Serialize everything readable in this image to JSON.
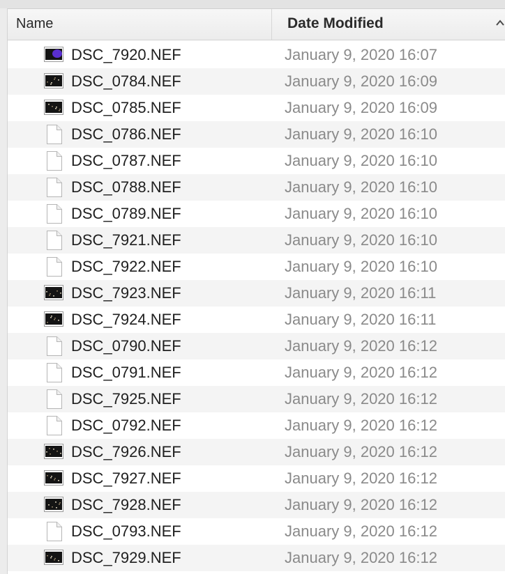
{
  "header": {
    "name_label": "Name",
    "date_label": "Date Modified"
  },
  "files": [
    {
      "name": "DSC_7920.NEF",
      "date": "January 9, 2020 16:07",
      "icon": "image-thumbnail-icon-purple"
    },
    {
      "name": "DSC_0784.NEF",
      "date": "January 9, 2020 16:09",
      "icon": "image-thumbnail-icon"
    },
    {
      "name": "DSC_0785.NEF",
      "date": "January 9, 2020 16:09",
      "icon": "image-thumbnail-icon"
    },
    {
      "name": "DSC_0786.NEF",
      "date": "January 9, 2020 16:10",
      "icon": "document-icon"
    },
    {
      "name": "DSC_0787.NEF",
      "date": "January 9, 2020 16:10",
      "icon": "document-icon"
    },
    {
      "name": "DSC_0788.NEF",
      "date": "January 9, 2020 16:10",
      "icon": "document-icon"
    },
    {
      "name": "DSC_0789.NEF",
      "date": "January 9, 2020 16:10",
      "icon": "document-icon"
    },
    {
      "name": "DSC_7921.NEF",
      "date": "January 9, 2020 16:10",
      "icon": "document-icon"
    },
    {
      "name": "DSC_7922.NEF",
      "date": "January 9, 2020 16:10",
      "icon": "document-icon"
    },
    {
      "name": "DSC_7923.NEF",
      "date": "January 9, 2020 16:11",
      "icon": "image-thumbnail-icon"
    },
    {
      "name": "DSC_7924.NEF",
      "date": "January 9, 2020 16:11",
      "icon": "image-thumbnail-icon"
    },
    {
      "name": "DSC_0790.NEF",
      "date": "January 9, 2020 16:12",
      "icon": "document-icon"
    },
    {
      "name": "DSC_0791.NEF",
      "date": "January 9, 2020 16:12",
      "icon": "document-icon"
    },
    {
      "name": "DSC_7925.NEF",
      "date": "January 9, 2020 16:12",
      "icon": "document-icon"
    },
    {
      "name": "DSC_0792.NEF",
      "date": "January 9, 2020 16:12",
      "icon": "document-icon"
    },
    {
      "name": "DSC_7926.NEF",
      "date": "January 9, 2020 16:12",
      "icon": "image-thumbnail-icon"
    },
    {
      "name": "DSC_7927.NEF",
      "date": "January 9, 2020 16:12",
      "icon": "image-thumbnail-icon"
    },
    {
      "name": "DSC_7928.NEF",
      "date": "January 9, 2020 16:12",
      "icon": "image-thumbnail-icon"
    },
    {
      "name": "DSC_0793.NEF",
      "date": "January 9, 2020 16:12",
      "icon": "document-icon"
    },
    {
      "name": "DSC_7929.NEF",
      "date": "January 9, 2020 16:12",
      "icon": "image-thumbnail-icon"
    }
  ],
  "colors": {
    "row_alt": "#f4f4f4",
    "date_text": "#8a8a8a",
    "name_text": "#1f1f1f"
  }
}
